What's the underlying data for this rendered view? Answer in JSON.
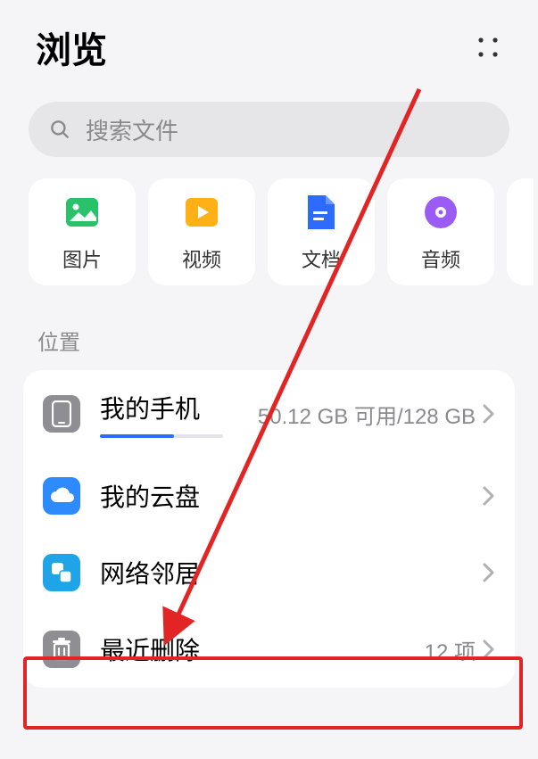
{
  "header": {
    "title": "浏览"
  },
  "search": {
    "placeholder": "搜索文件"
  },
  "categories": [
    {
      "key": "images",
      "label": "图片"
    },
    {
      "key": "video",
      "label": "视频"
    },
    {
      "key": "docs",
      "label": "文档"
    },
    {
      "key": "audio",
      "label": "音频"
    }
  ],
  "section": {
    "locations_title": "位置"
  },
  "locations": {
    "phone": {
      "label": "我的手机",
      "detail": "50.12 GB 可用/128 GB",
      "used_fraction": 0.6
    },
    "cloud": {
      "label": "我的云盘"
    },
    "network": {
      "label": "网络邻居"
    },
    "trash": {
      "label": "最近删除",
      "detail": "12 项"
    }
  }
}
